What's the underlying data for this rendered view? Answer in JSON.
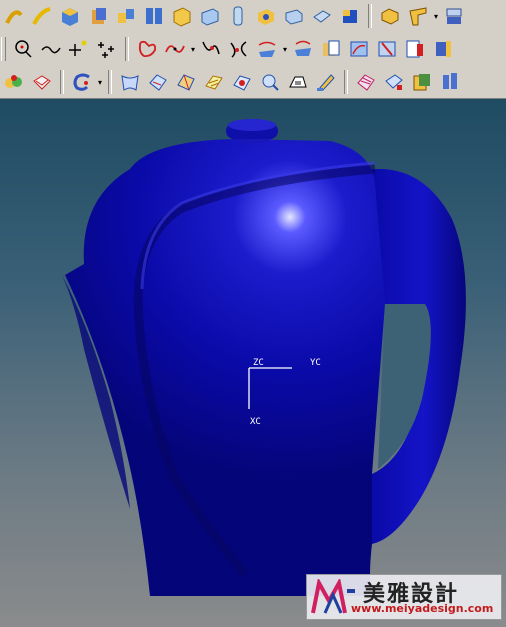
{
  "toolbars": {
    "row1": [
      "sketch-curve-icon",
      "arc-curve-icon",
      "block-icon",
      "cylinder-icon",
      "extrude-icon",
      "revolve-icon",
      "cube-icon",
      "box-icon",
      "pipe-icon",
      "hole-icon",
      "pocket-icon",
      "pad-icon",
      "slot-icon",
      "boss-icon",
      "chamfer-icon",
      "blend-icon",
      "draft-icon"
    ],
    "row2": [
      "circle-icon",
      "spline-icon",
      "point-icon",
      "point-set-icon",
      "offset-curve-icon",
      "helix-icon",
      "bridge-curve-icon",
      "intersect-curve-icon",
      "project-curve-icon",
      "combined-curve-icon",
      "isoparametric-curve-icon",
      "extract-curve-icon",
      "trim-curve-icon",
      "split-curve-icon",
      "divide-curve-icon"
    ],
    "row3": [
      "ruled-surface-icon",
      "through-curves-icon",
      "mesh-surface-icon",
      "swept-surface-icon",
      "section-surface-icon",
      "n-sided-surface-icon",
      "bounded-plane-icon",
      "offset-surface-icon",
      "trim-sheet-icon",
      "extension-surface-icon",
      "sew-icon",
      "thicken-icon",
      "patch-icon",
      "quilt-icon"
    ]
  },
  "wcs": {
    "zc": "ZC",
    "yc": "YC",
    "xc": "XC"
  },
  "watermark": {
    "title": "美雅設計",
    "url": "www.meiyadesign.com"
  },
  "colors": {
    "model": "#0a0a9e",
    "toolbar": "#d4d0c8"
  }
}
